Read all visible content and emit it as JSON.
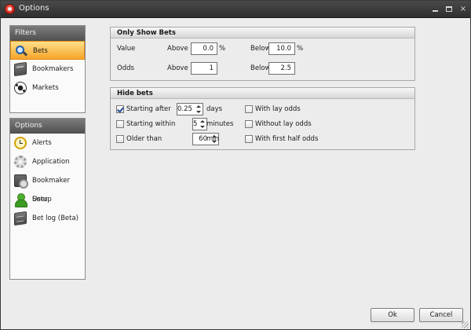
{
  "window": {
    "title": "Options",
    "minimize": "minimize",
    "maximize": "maximize",
    "close": "×"
  },
  "nav": {
    "filters": {
      "header": "Filters",
      "items": [
        {
          "label": "Bets",
          "icon": "search-icon",
          "selected": true
        },
        {
          "label": "Bookmakers",
          "icon": "book-icon"
        },
        {
          "label": "Markets",
          "icon": "soccer-ball-icon"
        }
      ]
    },
    "options": {
      "header": "Options",
      "items": [
        {
          "label": "Alerts",
          "icon": "alarm-clock-icon"
        },
        {
          "label": "Application",
          "icon": "gear-icon"
        },
        {
          "label": "Bookmaker Setup",
          "icon": "book-settings-icon"
        },
        {
          "label": "User",
          "icon": "user-icon"
        },
        {
          "label": "Bet log (Beta)",
          "icon": "log-book-icon"
        }
      ]
    }
  },
  "only_show": {
    "header": "Only Show Bets",
    "value_label": "Value",
    "odds_label": "Odds",
    "above_label": "Above",
    "below_label": "Below",
    "percent": "%",
    "value_above": "0.0",
    "value_below": "10.0",
    "odds_above": "1",
    "odds_below": "2.5"
  },
  "hide_bets": {
    "header": "Hide bets",
    "starting_after": {
      "label": "Starting after",
      "checked": true,
      "value": "0.25",
      "unit": "days"
    },
    "starting_within": {
      "label": "Starting within",
      "checked": false,
      "value": "5",
      "unit": "minutes"
    },
    "older_than": {
      "label": "Older than",
      "checked": false,
      "value": "60",
      "unit": "min"
    },
    "with_lay_odds": {
      "label": "With lay odds",
      "checked": false
    },
    "without_lay_odds": {
      "label": "Without lay odds",
      "checked": false
    },
    "with_first_half_odds": {
      "label": "With first half odds",
      "checked": false
    }
  },
  "buttons": {
    "ok": "Ok",
    "cancel": "Cancel"
  },
  "colors": {
    "selected_item": "#f6a52a",
    "titlebar": "#3a3a3a",
    "check_mark": "#2a4f9a"
  }
}
